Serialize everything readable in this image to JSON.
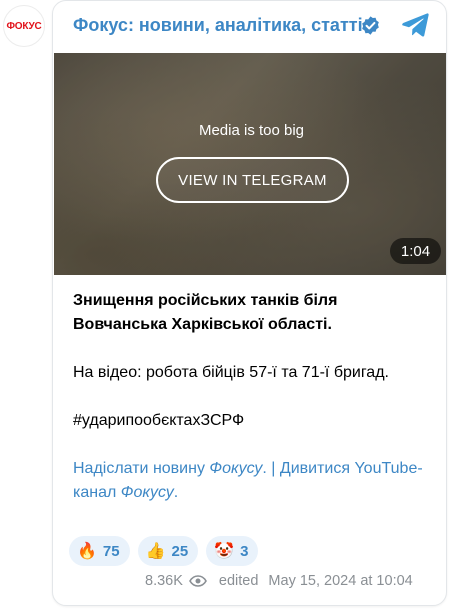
{
  "avatar": {
    "label": "ФОКУС"
  },
  "header": {
    "channel_name": "Фокус: новини, аналітика, статті",
    "verified_icon": "verified-check-icon",
    "app_icon": "telegram-icon"
  },
  "media": {
    "notice": "Media is too big",
    "button_label": "VIEW IN TELEGRAM",
    "duration": "1:04"
  },
  "post": {
    "title": "Знищення російських танків біля Вовчанська Харківської області.",
    "paragraph": "На відео: робота бійців 57-ї та 71-ї бригад.",
    "hashtag": "#ударипообєктахЗСРФ",
    "link1_prefix": "Надіслати новину ",
    "link1_italic": "Фокусу",
    "link1_suffix": ".",
    "separator": " | ",
    "link2_prefix": "Дивитися YouTube-канал ",
    "link2_italic": "Фокусу",
    "link2_suffix": "."
  },
  "reactions": [
    {
      "emoji": "🔥",
      "count": "75"
    },
    {
      "emoji": "👍",
      "count": "25"
    },
    {
      "emoji": "🤡",
      "count": "3"
    }
  ],
  "meta": {
    "views": "8.36K",
    "edited": "edited",
    "timestamp": "May 15, 2024 at 10:04"
  },
  "colors": {
    "accent": "#3d87c5",
    "brand_red": "#e1131b",
    "reaction_bg": "#e9f2fb",
    "meta_gray": "#8a8f94"
  }
}
